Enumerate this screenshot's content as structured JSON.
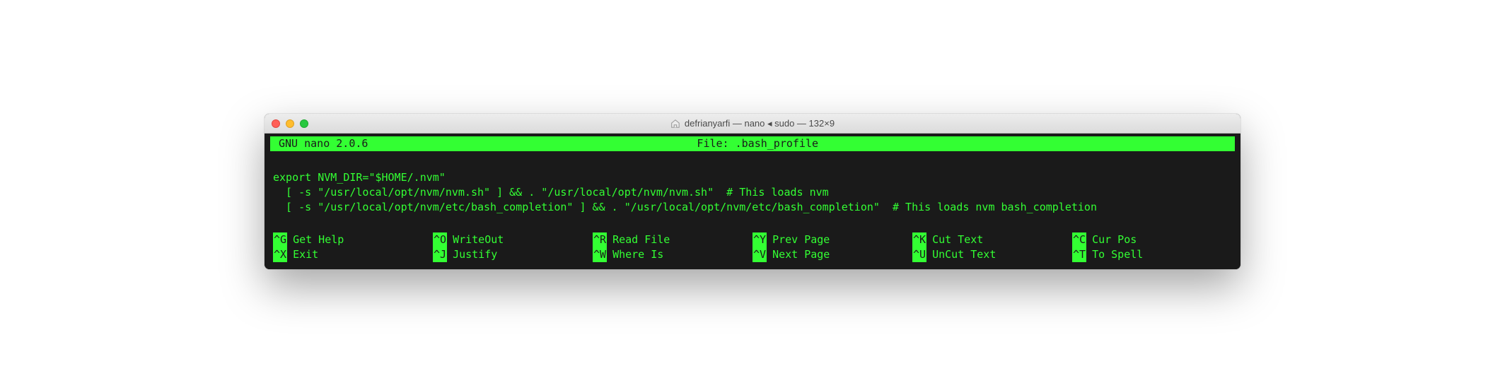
{
  "window": {
    "title": "defrianyarfi — nano ◂ sudo — 132×9"
  },
  "editor": {
    "app_name": "GNU nano 2.0.6",
    "file_label": "File: .bash_profile",
    "content_lines": [
      "export NVM_DIR=\"$HOME/.nvm\"",
      "  [ -s \"/usr/local/opt/nvm/nvm.sh\" ] && . \"/usr/local/opt/nvm/nvm.sh\"  # This loads nvm",
      "  [ -s \"/usr/local/opt/nvm/etc/bash_completion\" ] && . \"/usr/local/opt/nvm/etc/bash_completion\"  # This loads nvm bash_completion"
    ]
  },
  "shortcuts": {
    "row1": [
      {
        "key": "^G",
        "label": "Get Help"
      },
      {
        "key": "^O",
        "label": "WriteOut"
      },
      {
        "key": "^R",
        "label": "Read File"
      },
      {
        "key": "^Y",
        "label": "Prev Page"
      },
      {
        "key": "^K",
        "label": "Cut Text"
      },
      {
        "key": "^C",
        "label": "Cur Pos"
      }
    ],
    "row2": [
      {
        "key": "^X",
        "label": "Exit"
      },
      {
        "key": "^J",
        "label": "Justify"
      },
      {
        "key": "^W",
        "label": "Where Is"
      },
      {
        "key": "^V",
        "label": "Next Page"
      },
      {
        "key": "^U",
        "label": "UnCut Text"
      },
      {
        "key": "^T",
        "label": "To Spell"
      }
    ]
  }
}
